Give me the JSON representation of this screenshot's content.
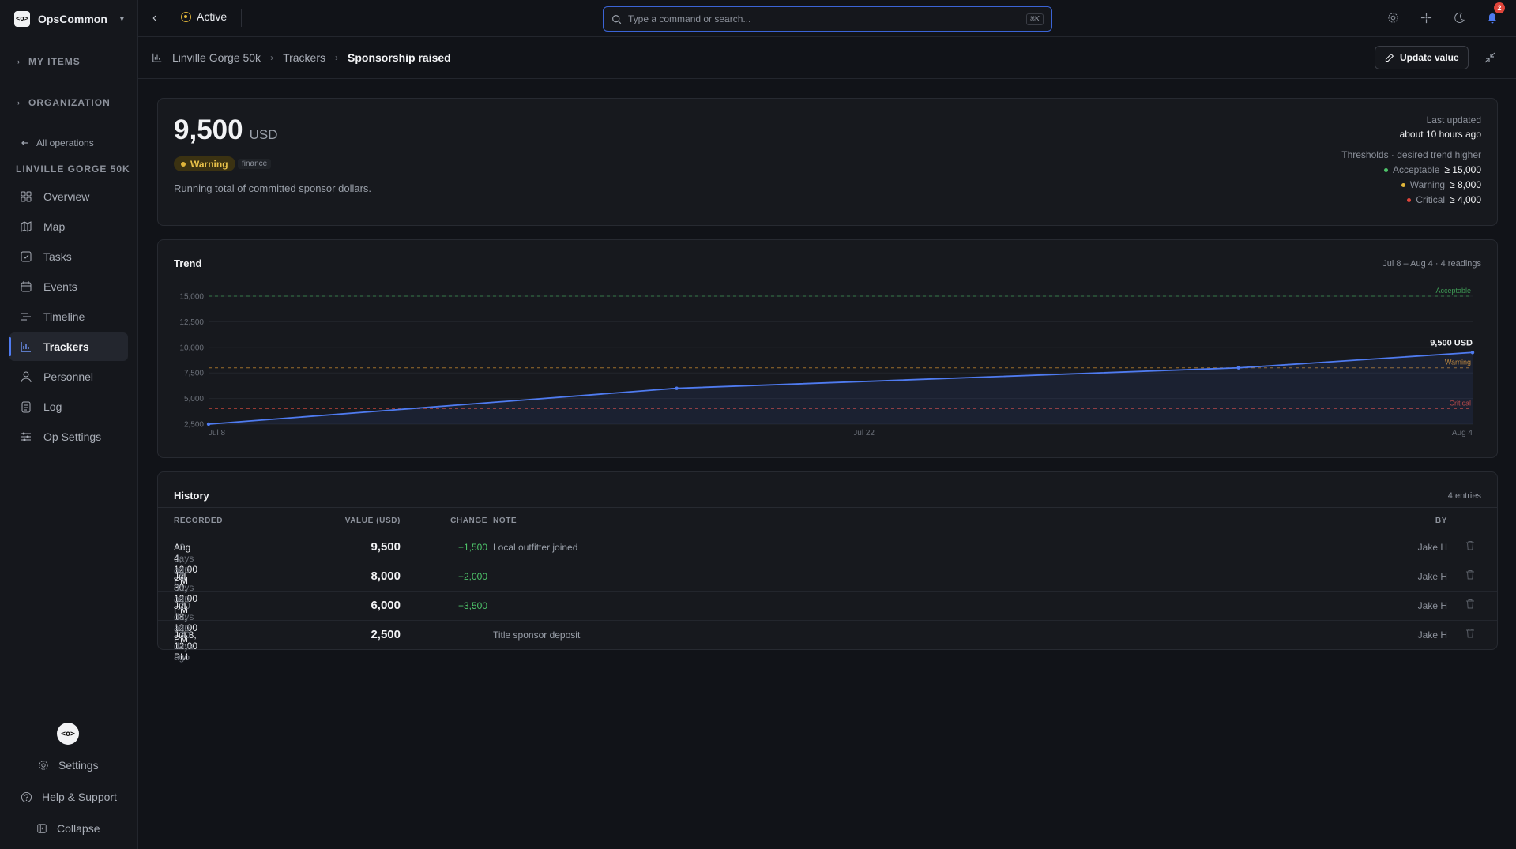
{
  "workspace": {
    "name": "OpsCommon",
    "logo_text": "<o>"
  },
  "sidebar": {
    "sections": [
      "MY ITEMS",
      "ORGANIZATION"
    ],
    "back_label": "All operations",
    "operation_title": "LINVILLE GORGE 50K",
    "items": [
      {
        "label": "Overview",
        "icon": "grid-icon"
      },
      {
        "label": "Map",
        "icon": "map-icon"
      },
      {
        "label": "Tasks",
        "icon": "checkbox-icon"
      },
      {
        "label": "Events",
        "icon": "calendar-icon"
      },
      {
        "label": "Timeline",
        "icon": "timeline-icon"
      },
      {
        "label": "Trackers",
        "icon": "bar-chart-icon",
        "active": true
      },
      {
        "label": "Personnel",
        "icon": "person-icon"
      },
      {
        "label": "Log",
        "icon": "clipboard-icon"
      },
      {
        "label": "Op Settings",
        "icon": "sliders-icon"
      }
    ],
    "bottom": {
      "logo_text": "<o>",
      "settings": "Settings",
      "help": "Help & Support",
      "collapse": "Collapse"
    }
  },
  "topbar": {
    "status": "Active",
    "search_placeholder": "Type a command or search...",
    "shortcut": "⌘K",
    "notification_count": "2"
  },
  "breadcrumb": {
    "items": [
      "Linville Gorge 50k",
      "Trackers",
      "Sponsorship raised"
    ],
    "action": "Update value"
  },
  "summary": {
    "value": "9,500",
    "unit": "USD",
    "status": "Warning",
    "tag": "finance",
    "description": "Running total of committed sponsor dollars.",
    "last_updated_label": "Last updated",
    "last_updated_value": "about 10 hours ago",
    "thresholds_title": "Thresholds · desired trend higher",
    "thresholds": [
      {
        "label": "Acceptable",
        "value": "≥ 15,000",
        "color": "#4ec46a"
      },
      {
        "label": "Warning",
        "value": "≥ 8,000",
        "color": "#e0b53a"
      },
      {
        "label": "Critical",
        "value": "≥ 4,000",
        "color": "#e0453a"
      }
    ]
  },
  "trend": {
    "title": "Trend",
    "meta": "Jul 8 – Aug 4 · 4 readings",
    "last_label": "9,500 USD"
  },
  "chart_data": {
    "type": "line",
    "x": [
      "Jul 8",
      "Jul 18",
      "Jul 30",
      "Aug 4"
    ],
    "values": [
      2500,
      6000,
      8000,
      9500
    ],
    "x_ticks": [
      "Jul 8",
      "Jul 22",
      "Aug 4"
    ],
    "y_ticks": [
      "2,500",
      "5,000",
      "7,500",
      "10,000",
      "12,500",
      "15,000"
    ],
    "y_tick_values": [
      2500,
      5000,
      7500,
      10000,
      12500,
      15000
    ],
    "ylim": [
      2500,
      15000
    ],
    "x_span_days": [
      0,
      27
    ],
    "x_days": [
      0,
      10,
      22,
      27
    ],
    "tick_days": [
      0,
      14,
      27
    ],
    "thresholds": [
      {
        "label": "Acceptable",
        "value": 15000,
        "color": "#3f9a55"
      },
      {
        "label": "Warning",
        "value": 8000,
        "color": "#c98a2e"
      },
      {
        "label": "Critical",
        "value": 4000,
        "color": "#c0453a"
      }
    ],
    "series_color": "#4f7bf0"
  },
  "history": {
    "title": "History",
    "meta": "4 entries",
    "columns": [
      "RECORDED",
      "VALUE (USD)",
      "CHANGE",
      "NOTE",
      "BY"
    ],
    "rows": [
      {
        "recorded": "Aug 4, 12:00 PM",
        "ago": "· 3 days ago",
        "value": "9,500",
        "change": "+1,500",
        "note": "Local outfitter joined",
        "by": "Jake H"
      },
      {
        "recorded": "Jul 30, 12:00 PM",
        "ago": "· 8 days ago",
        "value": "8,000",
        "change": "+2,000",
        "note": "",
        "by": "Jake H"
      },
      {
        "recorded": "Jul 18, 12:00 PM",
        "ago": "· 20 days ago",
        "value": "6,000",
        "change": "+3,500",
        "note": "",
        "by": "Jake H"
      },
      {
        "recorded": "Jul 8, 12:00 PM",
        "ago": "· 30 days ago",
        "value": "2,500",
        "change": "",
        "note": "Title sponsor deposit",
        "by": "Jake H"
      }
    ]
  }
}
